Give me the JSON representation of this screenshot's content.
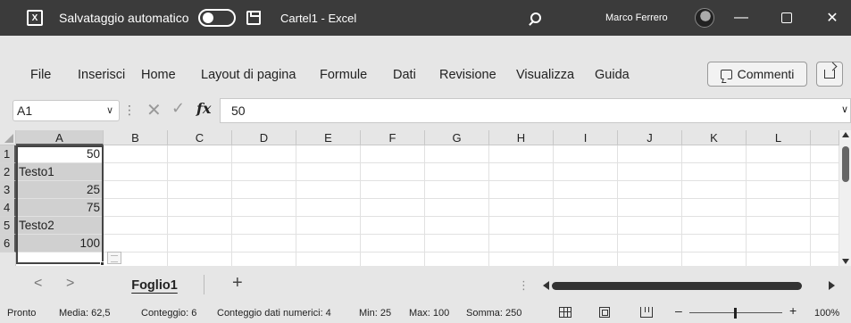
{
  "titlebar": {
    "autosave_label": "Salvataggio automatico",
    "doc_title": "Cartel1 - Excel",
    "user_name": "Marco Ferrero",
    "minimize": "—",
    "close": "✕",
    "logo_letter": "X"
  },
  "menu": {
    "items": [
      "File",
      "Inserisci",
      "Home",
      "Layout di pagina",
      "Formule",
      "Dati",
      "Revisione",
      "Visualizza",
      "Guida"
    ],
    "comments_label": "Commenti"
  },
  "formula_bar": {
    "name_box": "A1",
    "formula": "50",
    "fx_label": "fx",
    "cancel_symbol": "✕",
    "enter_symbol": "✓"
  },
  "sheet": {
    "columns": [
      "A",
      "B",
      "C",
      "D",
      "E",
      "F",
      "G",
      "H",
      "I",
      "J",
      "K",
      "L"
    ],
    "rows": [
      "1",
      "2",
      "3",
      "4",
      "5",
      "6"
    ],
    "cells": {
      "A1": "50",
      "A2": "Testo1",
      "A3": "25",
      "A4": "75",
      "A5": "Testo2",
      "A6": "100"
    },
    "selected_range": "A1:A6"
  },
  "tabs": {
    "prev": "<",
    "next": ">",
    "sheets": [
      "Foglio1"
    ],
    "active": "Foglio1",
    "add": "+",
    "dots": "⋮"
  },
  "status": {
    "ready": "Pronto",
    "average": "Media: 62,5",
    "count": "Conteggio: 6",
    "numeric_count": "Conteggio dati numerici: 4",
    "min": "Min: 25",
    "max": "Max: 100",
    "sum": "Somma: 250",
    "zoom": "100%",
    "zoom_minus": "–",
    "zoom_plus": "+"
  }
}
